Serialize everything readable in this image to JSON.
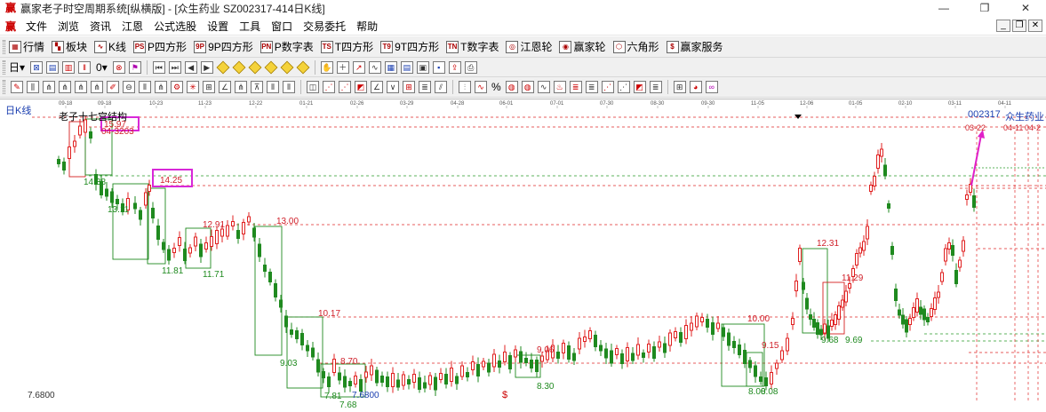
{
  "window": {
    "title": "赢家老子时空周期系统[纵横版] - [众生药业  SZ002317-414日K线]"
  },
  "menu": {
    "items": [
      "文件",
      "浏览",
      "资讯",
      "江恩",
      "公式选股",
      "设置",
      "工具",
      "窗口",
      "交易委托",
      "帮助"
    ]
  },
  "toolbar1": {
    "items": [
      {
        "name": "market",
        "label": "行情",
        "icon": "▦"
      },
      {
        "name": "sector",
        "label": "板块",
        "icon": "▚"
      },
      {
        "name": "kline",
        "label": "K线",
        "icon": "∿"
      },
      {
        "name": "p-square",
        "label": "P四方形",
        "icon": "PS"
      },
      {
        "name": "9p-square",
        "label": "9P四方形",
        "icon": "9P"
      },
      {
        "name": "p-number",
        "label": "P数字表",
        "icon": "PN"
      },
      {
        "name": "t-square",
        "label": "T四方形",
        "icon": "TS"
      },
      {
        "name": "9t-square",
        "label": "9T四方形",
        "icon": "T9"
      },
      {
        "name": "t-number",
        "label": "T数字表",
        "icon": "TN"
      },
      {
        "name": "gann-wheel",
        "label": "江恩轮",
        "icon": "◎"
      },
      {
        "name": "winner-wheel",
        "label": "赢家轮",
        "icon": "◉"
      },
      {
        "name": "hexagon",
        "label": "六角形",
        "icon": "⬡"
      },
      {
        "name": "winner-service",
        "label": "赢家服务",
        "icon": "$"
      }
    ]
  },
  "toolbar2": {
    "period_label": "日",
    "zero_label": "0"
  },
  "chart": {
    "period": "日K线",
    "title": "老子十七宫结构",
    "code": "002317",
    "name": "众生药业",
    "y_base_label": "7.6800",
    "dollar": "$",
    "dates": [
      "09-18",
      "09-18",
      "10-23",
      "11-23",
      "12-22",
      "01-21",
      "02-26",
      "03-29",
      "04-28",
      "06-01",
      "07-01",
      "07-30",
      "08-30",
      "09-30",
      "11-05",
      "12-06",
      "01-05",
      "02-10",
      "03-11",
      "04-11"
    ],
    "right_dates": [
      "03-22",
      "04-11",
      "04-2"
    ],
    "price_labels": [
      {
        "text": "15.97",
        "color": "#d0202a"
      },
      {
        "text": "14.25",
        "color": "#d0202a"
      },
      {
        "text": "14.38",
        "color": "#1f8a1f"
      },
      {
        "text": "13.11",
        "color": "#1f8a1f"
      },
      {
        "text": "12.91",
        "color": "#d0202a"
      },
      {
        "text": "13.00",
        "color": "#d0202a"
      },
      {
        "text": "11.81",
        "color": "#1f8a1f"
      },
      {
        "text": "11.71",
        "color": "#1f8a1f"
      },
      {
        "text": "10.17",
        "color": "#d0202a"
      },
      {
        "text": "9.03",
        "color": "#1f8a1f"
      },
      {
        "text": "8.70",
        "color": "#d0202a"
      },
      {
        "text": "7.81",
        "color": "#1f8a1f"
      },
      {
        "text": "7.6800",
        "color": "#1b3fb0"
      },
      {
        "text": "7.68",
        "color": "#1f8a1f"
      },
      {
        "text": "9.06",
        "color": "#d0202a"
      },
      {
        "text": "8.30",
        "color": "#1f8a1f"
      },
      {
        "text": "10.00",
        "color": "#d0202a"
      },
      {
        "text": "9.15",
        "color": "#d0202a"
      },
      {
        "text": "8.00",
        "color": "#1f8a1f"
      },
      {
        "text": "8.08",
        "color": "#1f8a1f"
      },
      {
        "text": "12.31",
        "color": "#d0202a"
      },
      {
        "text": "11.29",
        "color": "#d0202a"
      },
      {
        "text": "9.68",
        "color": "#1f8a1f"
      },
      {
        "text": "9.69",
        "color": "#1f8a1f"
      },
      {
        "text": "04-3203",
        "color": "#d0202a"
      }
    ]
  }
}
